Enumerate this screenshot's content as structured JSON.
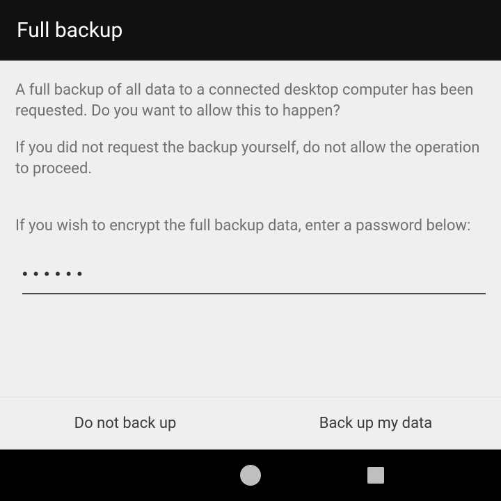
{
  "header": {
    "title": "Full backup"
  },
  "content": {
    "paragraph1": "A full backup of all data to a connected desktop computer has been requested. Do you want to allow this to happen?",
    "paragraph2": "If you did not request the backup yourself, do not allow the operation to proceed.",
    "encrypt_prompt": "If you wish to encrypt the full backup data, enter a password below:",
    "password_value": "••••••"
  },
  "buttons": {
    "deny": "Do not back up",
    "allow": "Back up my data"
  }
}
